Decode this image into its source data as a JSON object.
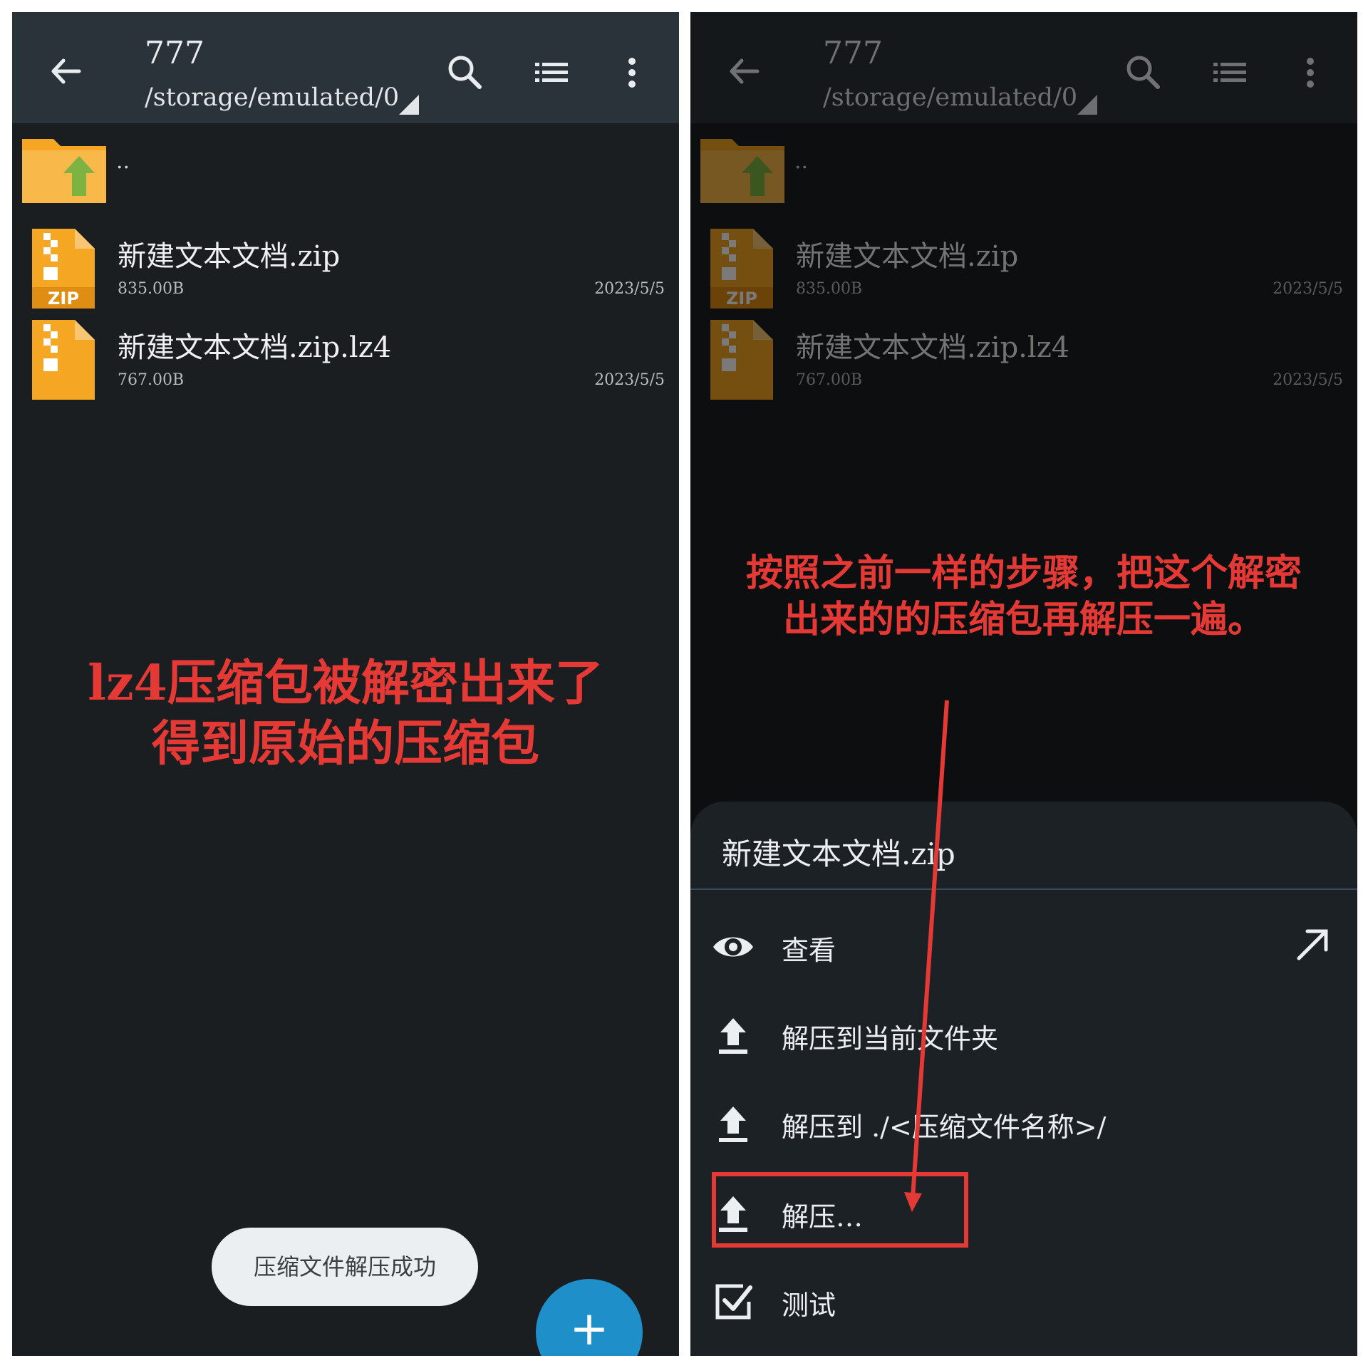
{
  "colors": {
    "topbar": "#2b333a",
    "background": "#1b1e21",
    "annotation": "#e53935",
    "fab": "#1e8fc8",
    "zip": "#f5a623",
    "folder_arrow": "#7cb342"
  },
  "toolbar": {
    "title": "777",
    "path": "/storage/emulated/0",
    "icons": [
      "back-arrow-icon",
      "search-icon",
      "list-view-icon",
      "more-vert-icon"
    ]
  },
  "files": [
    {
      "name": "..",
      "type": "parent-folder"
    },
    {
      "name": "新建文本文档.zip",
      "size": "835.00B",
      "date": "2023/5/5",
      "icon_label": "ZIP"
    },
    {
      "name": "新建文本文档.zip.lz4",
      "size": "767.00B",
      "date": "2023/5/5"
    }
  ],
  "left_annotation": {
    "line1": "lz4压缩包被解密出来了",
    "line2": "得到原始的压缩包"
  },
  "toast": "压缩文件解压成功",
  "fab": "+",
  "right_annotation": {
    "line1": "按照之前一样的步骤，把这个解密",
    "line2": "出来的的压缩包再解压一遍。"
  },
  "sheet": {
    "title": "新建文本文档.zip",
    "actions": [
      {
        "label": "查看",
        "icon": "eye-icon"
      },
      {
        "label": "解压到当前文件夹",
        "icon": "upload-icon"
      },
      {
        "label": "解压到 ./<压缩文件名称>/",
        "icon": "upload-icon"
      },
      {
        "label": "解压…",
        "icon": "upload-icon"
      },
      {
        "label": "测试",
        "icon": "checkbox-icon"
      }
    ]
  }
}
